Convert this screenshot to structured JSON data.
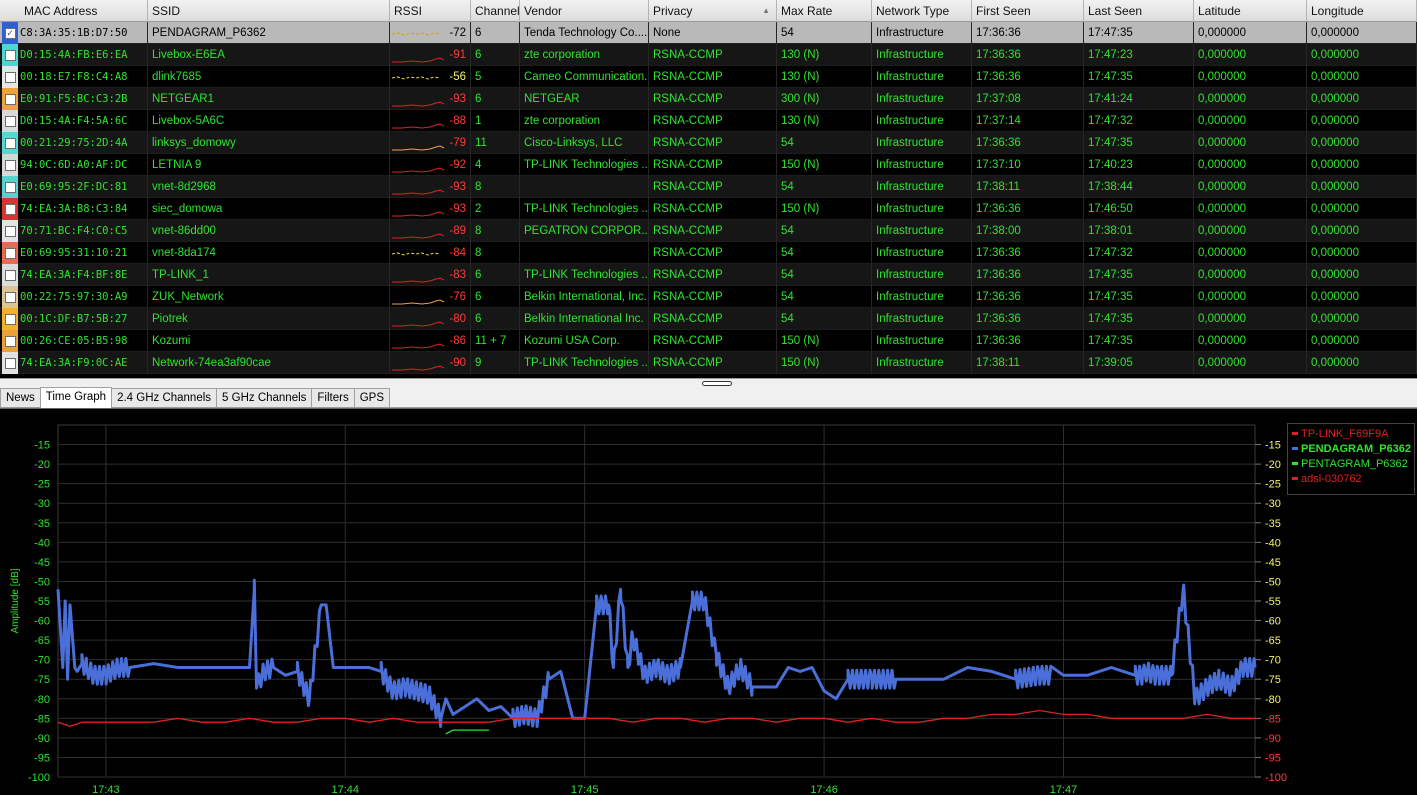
{
  "table": {
    "columns": [
      {
        "label": "MAC Address",
        "w": 148
      },
      {
        "label": "SSID",
        "w": 242
      },
      {
        "label": "RSSI",
        "w": 81
      },
      {
        "label": "Channel",
        "w": 49
      },
      {
        "label": "Vendor",
        "w": 129
      },
      {
        "label": "Privacy",
        "w": 128
      },
      {
        "label": "Max Rate",
        "w": 95
      },
      {
        "label": "Network Type",
        "w": 100
      },
      {
        "label": "First Seen",
        "w": 112
      },
      {
        "label": "Last Seen",
        "w": 110
      },
      {
        "label": "Latitude",
        "w": 113
      },
      {
        "label": "Longitude",
        "w": 110
      }
    ],
    "sorted_column_arrow": "▲",
    "rows": [
      {
        "checked": true,
        "color": "#2f5fd1",
        "mac": "C8:3A:35:1B:D7:50",
        "ssid": "PENDAGRAM_P6362",
        "rssi": "-72",
        "rssi_color": "black",
        "spark": "yellow-dotted",
        "channel": "6",
        "vendor": "Tenda Technology Co....",
        "privacy": "None",
        "max_rate": "54",
        "network_type": "Infrastructure",
        "first_seen": "17:36:36",
        "last_seen": "17:47:35",
        "latitude": "0,000000",
        "longitude": "0,000000"
      },
      {
        "checked": false,
        "color": "#4fd6d2",
        "mac": "D0:15:4A:FB:E6:EA",
        "ssid": "Livebox-E6EA",
        "rssi": "-91",
        "rssi_color": "red",
        "spark": "red",
        "channel": "6",
        "vendor": "zte corporation",
        "privacy": "RSNA-CCMP",
        "max_rate": "130 (N)",
        "network_type": "Infrastructure",
        "first_seen": "17:36:36",
        "last_seen": "17:47:23",
        "latitude": "0,000000",
        "longitude": "0,000000"
      },
      {
        "checked": false,
        "color": "#e6e6e6",
        "mac": "00:18:E7:F8:C4:A8",
        "ssid": "dlink7685",
        "rssi": "-56",
        "rssi_color": "yellow",
        "spark": "yellow-dotted",
        "channel": "5",
        "vendor": "Cameo Communication...",
        "privacy": "RSNA-CCMP",
        "max_rate": "130 (N)",
        "network_type": "Infrastructure",
        "first_seen": "17:36:36",
        "last_seen": "17:47:35",
        "latitude": "0,000000",
        "longitude": "0,000000"
      },
      {
        "checked": false,
        "color": "#f2a23a",
        "mac": "E0:91:F5:BC:C3:2B",
        "ssid": "NETGEAR1",
        "rssi": "-93",
        "rssi_color": "red",
        "spark": "red",
        "channel": "6",
        "vendor": "NETGEAR",
        "privacy": "RSNA-CCMP",
        "max_rate": "300 (N)",
        "network_type": "Infrastructure",
        "first_seen": "17:37:08",
        "last_seen": "17:41:24",
        "latitude": "0,000000",
        "longitude": "0,000000"
      },
      {
        "checked": false,
        "color": "#d9d9d9",
        "mac": "D0:15:4A:F4:5A:6C",
        "ssid": "Livebox-5A6C",
        "rssi": "-88",
        "rssi_color": "red",
        "spark": "red",
        "channel": "1",
        "vendor": "zte corporation",
        "privacy": "RSNA-CCMP",
        "max_rate": "130 (N)",
        "network_type": "Infrastructure",
        "first_seen": "17:37:14",
        "last_seen": "17:47:32",
        "latitude": "0,000000",
        "longitude": "0,000000"
      },
      {
        "checked": false,
        "color": "#58d6d0",
        "mac": "00:21:29:75:2D:4A",
        "ssid": "linksys_domowy",
        "rssi": "-79",
        "rssi_color": "red",
        "spark": "orange",
        "channel": "11",
        "vendor": "Cisco-Linksys, LLC",
        "privacy": "RSNA-CCMP",
        "max_rate": "54",
        "network_type": "Infrastructure",
        "first_seen": "17:36:36",
        "last_seen": "17:47:35",
        "latitude": "0,000000",
        "longitude": "0,000000"
      },
      {
        "checked": false,
        "color": "#d7d7d7",
        "mac": "94:0C:6D:A0:AF:DC",
        "ssid": "LETNIA 9",
        "rssi": "-92",
        "rssi_color": "red",
        "spark": "red",
        "channel": "4",
        "vendor": "TP-LINK Technologies ...",
        "privacy": "RSNA-CCMP",
        "max_rate": "150 (N)",
        "network_type": "Infrastructure",
        "first_seen": "17:37:10",
        "last_seen": "17:40:23",
        "latitude": "0,000000",
        "longitude": "0,000000"
      },
      {
        "checked": false,
        "color": "#59d3cf",
        "mac": "E0:69:95:2F:DC:81",
        "ssid": "vnet-8d2968",
        "rssi": "-93",
        "rssi_color": "red",
        "spark": "red",
        "channel": "8",
        "vendor": "",
        "privacy": "RSNA-CCMP",
        "max_rate": "54",
        "network_type": "Infrastructure",
        "first_seen": "17:38:11",
        "last_seen": "17:38:44",
        "latitude": "0,000000",
        "longitude": "0,000000"
      },
      {
        "checked": false,
        "color": "#e03131",
        "mac": "74:EA:3A:B8:C3:84",
        "ssid": "siec_domowa",
        "rssi": "-93",
        "rssi_color": "red",
        "spark": "red",
        "channel": "2",
        "vendor": "TP-LINK Technologies ...",
        "privacy": "RSNA-CCMP",
        "max_rate": "150 (N)",
        "network_type": "Infrastructure",
        "first_seen": "17:36:36",
        "last_seen": "17:46:50",
        "latitude": "0,000000",
        "longitude": "0,000000"
      },
      {
        "checked": false,
        "color": "#e3e3e3",
        "mac": "70:71:BC:F4:C0:C5",
        "ssid": "vnet-86dd00",
        "rssi": "-89",
        "rssi_color": "red",
        "spark": "red",
        "channel": "8",
        "vendor": "PEGATRON CORPOR...",
        "privacy": "RSNA-CCMP",
        "max_rate": "54",
        "network_type": "Infrastructure",
        "first_seen": "17:38:00",
        "last_seen": "17:38:01",
        "latitude": "0,000000",
        "longitude": "0,000000"
      },
      {
        "checked": false,
        "color": "#e86a55",
        "mac": "E0:69:95:31:10:21",
        "ssid": "vnet-8da174",
        "rssi": "-84",
        "rssi_color": "red",
        "spark": "yellow-dotted",
        "channel": "8",
        "vendor": "",
        "privacy": "RSNA-CCMP",
        "max_rate": "54",
        "network_type": "Infrastructure",
        "first_seen": "17:36:36",
        "last_seen": "17:47:32",
        "latitude": "0,000000",
        "longitude": "0,000000"
      },
      {
        "checked": false,
        "color": "#dcdcdc",
        "mac": "74:EA:3A:F4:BF:8E",
        "ssid": "TP-LINK_1",
        "rssi": "-83",
        "rssi_color": "red",
        "spark": "red",
        "channel": "6",
        "vendor": "TP-LINK Technologies ...",
        "privacy": "RSNA-CCMP",
        "max_rate": "54",
        "network_type": "Infrastructure",
        "first_seen": "17:36:36",
        "last_seen": "17:47:35",
        "latitude": "0,000000",
        "longitude": "0,000000"
      },
      {
        "checked": false,
        "color": "#dbc591",
        "mac": "00:22:75:97:30:A9",
        "ssid": "ZUK_Network",
        "rssi": "-76",
        "rssi_color": "red",
        "spark": "orange",
        "channel": "6",
        "vendor": "Belkin International, Inc.",
        "privacy": "RSNA-CCMP",
        "max_rate": "54",
        "network_type": "Infrastructure",
        "first_seen": "17:36:36",
        "last_seen": "17:47:35",
        "latitude": "0,000000",
        "longitude": "0,000000"
      },
      {
        "checked": false,
        "color": "#f5b030",
        "mac": "00:1C:DF:B7:5B:27",
        "ssid": "Piotrek",
        "rssi": "-80",
        "rssi_color": "red",
        "spark": "red",
        "channel": "6",
        "vendor": "Belkin International Inc.",
        "privacy": "RSNA-CCMP",
        "max_rate": "54",
        "network_type": "Infrastructure",
        "first_seen": "17:36:36",
        "last_seen": "17:47:35",
        "latitude": "0,000000",
        "longitude": "0,000000"
      },
      {
        "checked": false,
        "color": "#e9a13a",
        "mac": "00:26:CE:05:B5:98",
        "ssid": "Kozumi",
        "rssi": "-86",
        "rssi_color": "red",
        "spark": "red",
        "channel": "11 + 7",
        "vendor": "Kozumi USA Corp.",
        "privacy": "RSNA-CCMP",
        "max_rate": "150 (N)",
        "network_type": "Infrastructure",
        "first_seen": "17:36:36",
        "last_seen": "17:47:35",
        "latitude": "0,000000",
        "longitude": "0,000000"
      },
      {
        "checked": false,
        "color": "#e2e2e2",
        "mac": "74:EA:3A:F9:0C:AE",
        "ssid": "Network-74ea3af90cae",
        "rssi": "-90",
        "rssi_color": "red",
        "spark": "red",
        "channel": "9",
        "vendor": "TP-LINK Technologies ...",
        "privacy": "RSNA-CCMP",
        "max_rate": "150 (N)",
        "network_type": "Infrastructure",
        "first_seen": "17:38:11",
        "last_seen": "17:39:05",
        "latitude": "0,000000",
        "longitude": "0,000000"
      }
    ]
  },
  "tabs": [
    {
      "label": "News",
      "active": false
    },
    {
      "label": "Time Graph",
      "active": true
    },
    {
      "label": "2.4 GHz Channels",
      "active": false
    },
    {
      "label": "5 GHz Channels",
      "active": false
    },
    {
      "label": "Filters",
      "active": false
    },
    {
      "label": "GPS",
      "active": false
    }
  ],
  "colors": {
    "grid": "#2f2f2f",
    "axis_text_left": "#2fe32f",
    "axis_text_right_yellow": "#f4f36a",
    "axis_text_right_red": "#ff3b3b",
    "series_blue": "#4a6fd8",
    "series_red": "#e02020",
    "series_green": "#2fe32f"
  },
  "chart_data": {
    "type": "line",
    "ylabel": "Amplitude [dB]",
    "ylim": [
      -100,
      -10
    ],
    "yticks": [
      -15,
      -20,
      -25,
      -30,
      -35,
      -40,
      -45,
      -50,
      -55,
      -60,
      -65,
      -70,
      -75,
      -80,
      -85,
      -90,
      -95,
      -100
    ],
    "xticks": [
      "17:43",
      "17:44",
      "17:45",
      "17:46",
      "17:47"
    ],
    "xlim_minutes": [
      42.8,
      47.8
    ],
    "legend": [
      {
        "name": "TP-LINK_F69F9A",
        "color": "#e02020",
        "bold": false
      },
      {
        "name": "PENDAGRAM_P6362",
        "color": "#4a6fd8",
        "bold": true
      },
      {
        "name": "PENTAGRAM_P6362",
        "color": "#2fe32f",
        "bold": false
      },
      {
        "name": "adsl-030762",
        "color": "#e02020",
        "bold": false
      }
    ],
    "series": [
      {
        "name": "PENDAGRAM_P6362",
        "color": "#4a6fd8",
        "x": [
          42.8,
          42.82,
          42.83,
          42.84,
          42.85,
          42.87,
          42.88,
          42.9,
          42.92,
          42.95,
          43.0,
          43.05,
          43.1,
          43.2,
          43.3,
          43.4,
          43.5,
          43.6,
          43.62,
          43.63,
          43.66,
          43.7,
          43.75,
          43.8,
          43.85,
          43.9,
          43.92,
          43.95,
          44.0,
          44.05,
          44.1,
          44.15,
          44.2,
          44.25,
          44.3,
          44.35,
          44.4,
          44.42,
          44.45,
          44.5,
          44.55,
          44.6,
          44.65,
          44.7,
          44.75,
          44.8,
          44.85,
          44.9,
          44.95,
          45.0,
          45.05,
          45.1,
          45.12,
          45.15,
          45.18,
          45.2,
          45.25,
          45.3,
          45.35,
          45.4,
          45.45,
          45.5,
          45.55,
          45.6,
          45.65,
          45.7,
          45.75,
          45.8,
          45.85,
          45.9,
          45.95,
          46.0,
          46.05,
          46.1,
          46.15,
          46.2,
          46.25,
          46.3,
          46.4,
          46.5,
          46.6,
          46.7,
          46.8,
          46.9,
          47.0,
          47.1,
          47.2,
          47.25,
          47.3,
          47.33,
          47.35,
          47.38,
          47.4,
          47.45,
          47.5,
          47.55,
          47.6,
          47.65,
          47.7,
          47.75,
          47.8
        ],
        "values": [
          -52,
          -72,
          -55,
          -75,
          -56,
          -72,
          -73,
          -71,
          -72,
          -74,
          -74,
          -72,
          -72,
          -71,
          -72,
          -72,
          -72,
          -72,
          -52,
          -77,
          -73,
          -72,
          -74,
          -73,
          -80,
          -56,
          -56,
          -72,
          -72,
          -72,
          -72,
          -73,
          -78,
          -77,
          -78,
          -79,
          -85,
          -80,
          -84,
          -82,
          -80,
          -83,
          -82,
          -85,
          -84,
          -85,
          -75,
          -73,
          -85,
          -85,
          -56,
          -56,
          -72,
          -52,
          -72,
          -64,
          -74,
          -72,
          -74,
          -72,
          -55,
          -55,
          -69,
          -77,
          -72,
          -77,
          -77,
          -77,
          -72,
          -73,
          -72,
          -78,
          -80,
          -75,
          -75,
          -75,
          -75,
          -75,
          -75,
          -75,
          -72,
          -73,
          -75,
          -74,
          -74,
          -74,
          -72,
          -73,
          -74,
          -74,
          -73,
          -74,
          -74,
          -74,
          -52,
          -80,
          -77,
          -75,
          -77,
          -72,
          -72
        ],
        "dense_oscillation_ranges_minutes": [
          [
            42.9,
            43.1
          ],
          [
            43.62,
            43.7
          ],
          [
            43.8,
            43.9
          ],
          [
            44.15,
            44.4
          ],
          [
            44.7,
            44.85
          ],
          [
            45.05,
            45.4
          ],
          [
            45.45,
            45.7
          ],
          [
            46.1,
            46.3
          ],
          [
            46.8,
            46.95
          ],
          [
            47.3,
            47.8
          ]
        ]
      },
      {
        "name": "TP-LINK_F69F9A",
        "color": "#e02020",
        "x": [
          42.8,
          42.85,
          42.9,
          43.0,
          43.1,
          43.2,
          43.3,
          43.4,
          43.5,
          43.6,
          43.7,
          43.8,
          43.9,
          44.0,
          44.1,
          44.2,
          44.3,
          44.4,
          44.5,
          44.6,
          44.7,
          44.8,
          44.9,
          45.0,
          45.1,
          45.2,
          45.3,
          45.4,
          45.5,
          45.6,
          45.7,
          45.8,
          45.9,
          46.0,
          46.1,
          46.2,
          46.3,
          46.4,
          46.5,
          46.6,
          46.7,
          46.8,
          46.9,
          47.0,
          47.1,
          47.2,
          47.3,
          47.4,
          47.5,
          47.6,
          47.7,
          47.8
        ],
        "values": [
          -86,
          -87,
          -86,
          -86,
          -86,
          -86,
          -85,
          -86,
          -86,
          -85,
          -86,
          -86,
          -85,
          -85,
          -86,
          -85,
          -86,
          -86,
          -86,
          -86,
          -85,
          -85,
          -85,
          -85,
          -85,
          -86,
          -85,
          -85,
          -86,
          -85,
          -85,
          -86,
          -85,
          -85,
          -86,
          -85,
          -86,
          -86,
          -85,
          -85,
          -84,
          -84,
          -83,
          -84,
          -84,
          -85,
          -85,
          -85,
          -85,
          -84,
          -85,
          -85
        ]
      },
      {
        "name": "PENTAGRAM_P6362",
        "color": "#2fe32f",
        "x": [
          44.42,
          44.45,
          44.55,
          44.6
        ],
        "values": [
          -89,
          -88,
          -88,
          -88
        ]
      }
    ]
  }
}
